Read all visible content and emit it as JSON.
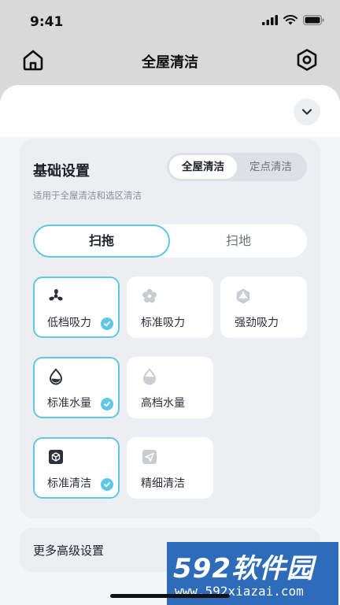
{
  "status": {
    "time": "9:41"
  },
  "nav": {
    "title": "全屋清洁"
  },
  "settings": {
    "title": "基础设置",
    "subtitle": "适用于全屋清洁和选区清洁",
    "scope_options": [
      "全屋清洁",
      "定点清洁"
    ],
    "scope_selected": "全屋清洁",
    "mode_options": [
      "扫拖",
      "扫地"
    ],
    "mode_selected": "扫拖",
    "suction": [
      {
        "label": "低档吸力",
        "selected": true
      },
      {
        "label": "标准吸力",
        "selected": false
      },
      {
        "label": "强劲吸力",
        "selected": false
      }
    ],
    "water": [
      {
        "label": "标准水量",
        "selected": true
      },
      {
        "label": "高档水量",
        "selected": false
      }
    ],
    "clean": [
      {
        "label": "标准清洁",
        "selected": true
      },
      {
        "label": "精细清洁",
        "selected": false
      }
    ]
  },
  "more": {
    "label": "更多高级设置"
  },
  "watermark": {
    "brand": "592软件园",
    "url": "www.592xiazai.com"
  },
  "colors": {
    "accent": "#5ec8e5",
    "card": "#eceef1",
    "sheet": "#f4f5f7",
    "watermark": "#2e6bb8"
  },
  "icons": [
    "home-icon",
    "hexagon-settings-icon",
    "chevron-down-icon",
    "fan-icon",
    "water-drop-icon",
    "cube-icon",
    "send-arrow-icon",
    "check-icon",
    "chevron-right-icon"
  ]
}
